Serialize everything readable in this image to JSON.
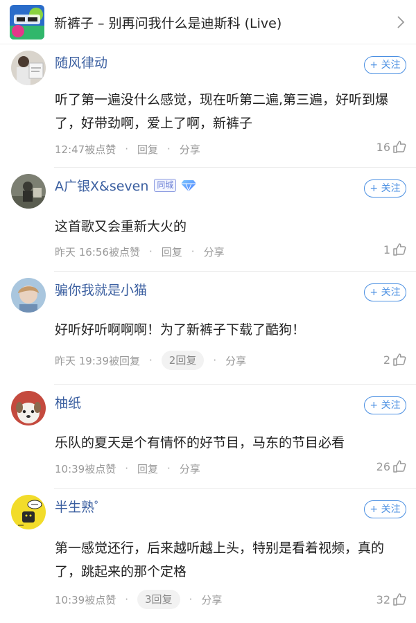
{
  "header": {
    "title": "新裤子 – 别再问我什么是迪斯科 (Live)"
  },
  "comments": [
    {
      "user": "随风律动",
      "tag": "",
      "follow": "+ 关注",
      "text": "听了第一遍没什么感觉，现在听第二遍,第三遍，好听到爆了，好带劲啊，爱上了啊，新裤子",
      "time": "12:47被点赞",
      "reply": "回复",
      "share": "分享",
      "likes": "16"
    },
    {
      "user": "A广银X&seven",
      "tag": "同城",
      "follow": "+ 关注",
      "text": "这首歌又会重新大火的",
      "time": "昨天 16:56被点赞",
      "reply": "回复",
      "share": "分享",
      "likes": "1"
    },
    {
      "user": "骗你我就是小猫",
      "tag": "",
      "follow": "+ 关注",
      "text": "好听好听啊啊啊！为了新裤子下载了酷狗！",
      "time": "昨天 19:39被回复",
      "reply": "2回复",
      "share": "分享",
      "likes": "2"
    },
    {
      "user": "柚纸",
      "tag": "",
      "follow": "+ 关注",
      "text": "乐队的夏天是个有情怀的好节目，马东的节目必看",
      "time": "10:39被点赞",
      "reply": "回复",
      "share": "分享",
      "likes": "26"
    },
    {
      "user": "半生熟゜",
      "tag": "",
      "follow": "+ 关注",
      "text": "第一感觉还行，后来越听越上头，特别是看着视频，真的了，跳起来的那个定格",
      "time": "10:39被点赞",
      "reply": "3回复",
      "share": "分享",
      "likes": "32"
    }
  ],
  "colors": {
    "username": "#3b5fa0",
    "accent": "#4a8fe2",
    "meta": "#999999"
  }
}
